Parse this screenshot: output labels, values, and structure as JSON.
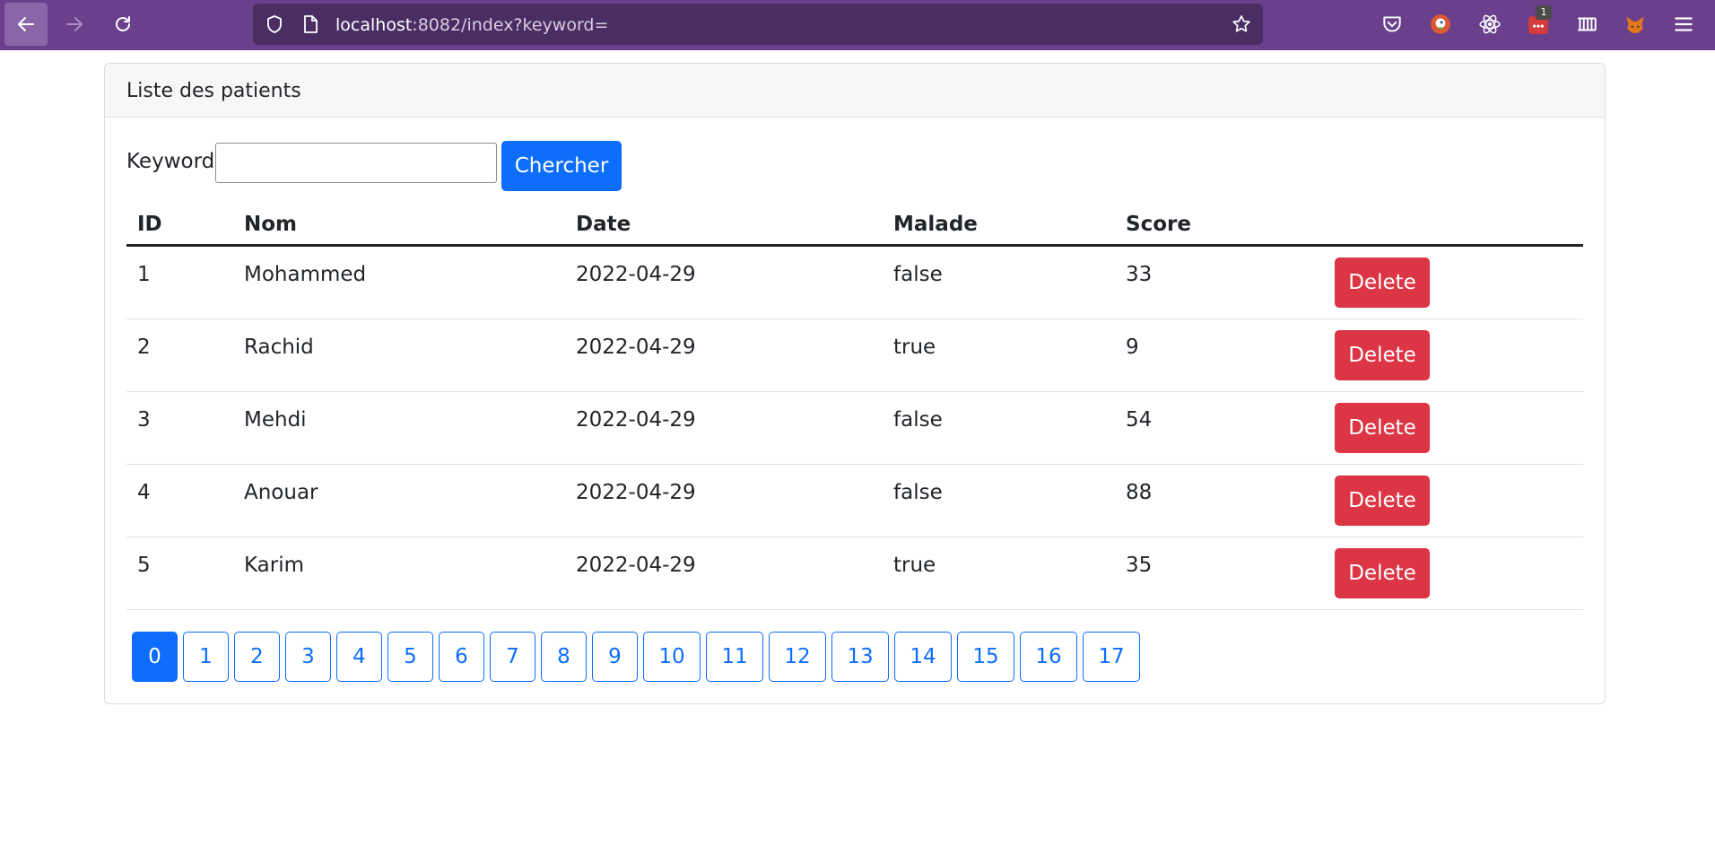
{
  "browser": {
    "url_host": "localhost",
    "url_rest": ":8082/index?keyword=",
    "extension_badge": "1",
    "icons": [
      "back-arrow-icon",
      "forward-arrow-icon",
      "reload-icon",
      "shield-icon",
      "page-icon",
      "star-icon",
      "pocket-icon",
      "duckduckgo-icon",
      "react-icon",
      "extension-icon",
      "ruler-icon",
      "fox-icon",
      "menu-icon"
    ]
  },
  "card": {
    "title": "Liste des patients"
  },
  "search": {
    "label": "Keyword",
    "value": "",
    "button_label": "Chercher"
  },
  "table": {
    "headers": {
      "id": "ID",
      "nom": "Nom",
      "date": "Date",
      "malade": "Malade",
      "score": "Score"
    },
    "rows": [
      {
        "id": "1",
        "nom": "Mohammed",
        "date": "2022-04-29",
        "malade": "false",
        "score": "33",
        "action": "Delete"
      },
      {
        "id": "2",
        "nom": "Rachid",
        "date": "2022-04-29",
        "malade": "true",
        "score": "9",
        "action": "Delete"
      },
      {
        "id": "3",
        "nom": "Mehdi",
        "date": "2022-04-29",
        "malade": "false",
        "score": "54",
        "action": "Delete"
      },
      {
        "id": "4",
        "nom": "Anouar",
        "date": "2022-04-29",
        "malade": "false",
        "score": "88",
        "action": "Delete"
      },
      {
        "id": "5",
        "nom": "Karim",
        "date": "2022-04-29",
        "malade": "true",
        "score": "35",
        "action": "Delete"
      }
    ]
  },
  "pagination": {
    "pages": [
      "0",
      "1",
      "2",
      "3",
      "4",
      "5",
      "6",
      "7",
      "8",
      "9",
      "10",
      "11",
      "12",
      "13",
      "14",
      "15",
      "16",
      "17"
    ],
    "active": "0"
  },
  "colors": {
    "toolbar": "#6a3f8c",
    "primary": "#0d6efd",
    "danger": "#dc3545"
  }
}
